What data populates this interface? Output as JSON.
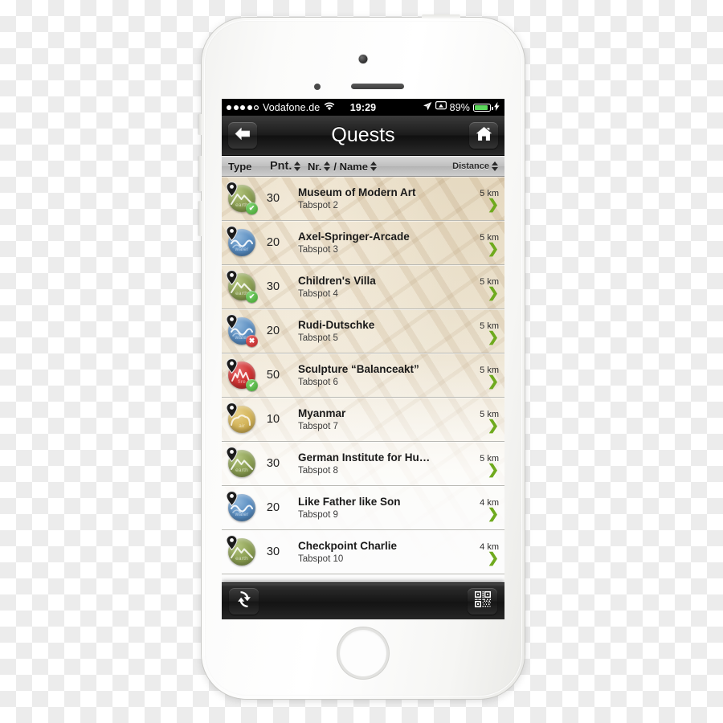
{
  "status_bar": {
    "signal_dots_filled": 4,
    "signal_dots_total": 5,
    "carrier": "Vodafone.de",
    "wifi_icon": "wifi-icon",
    "time": "19:29",
    "location_icon": "location-arrow-icon",
    "airplay_icon": "airplay-icon",
    "battery_percent": "89%",
    "battery_level": 89,
    "charging_icon": "lightning-bolt-icon"
  },
  "nav_bar": {
    "back_icon": "back-arrow-icon",
    "title": "Quests",
    "home_icon": "home-icon"
  },
  "table_header": {
    "type": "Type",
    "points": "Pnt.",
    "number": "Nr.",
    "name": "/ Name",
    "distance": "Distance",
    "sort_icon": "sort-updown-icon"
  },
  "colors": {
    "earth": "#8da055",
    "water": "#5c8fc2",
    "fire": "#cf3434",
    "air": "#d4b55b",
    "chevron_green": "#6faa1e",
    "battery_green": "#5bd75b"
  },
  "quests": [
    {
      "element": "earth",
      "element_label": "earth",
      "status": "ok",
      "points": "30",
      "name": "Museum of Modern Art",
      "subtitle": "Tabspot 2",
      "distance": "5 km"
    },
    {
      "element": "water",
      "element_label": "water",
      "status": "none",
      "points": "20",
      "name": "Axel-Springer-Arcade",
      "subtitle": "Tabspot 3",
      "distance": "5 km"
    },
    {
      "element": "earth",
      "element_label": "earth",
      "status": "ok",
      "points": "30",
      "name": "Children's Villa",
      "subtitle": "Tabspot 4",
      "distance": "5 km"
    },
    {
      "element": "water",
      "element_label": "water",
      "status": "no",
      "points": "20",
      "name": "Rudi-Dutschke",
      "subtitle": "Tabspot 5",
      "distance": "5 km"
    },
    {
      "element": "fire",
      "element_label": "fire",
      "status": "ok",
      "points": "50",
      "name": "Sculpture “Balanceakt”",
      "subtitle": "Tabspot 6",
      "distance": "5 km"
    },
    {
      "element": "air",
      "element_label": "air",
      "status": "none",
      "points": "10",
      "name": "Myanmar",
      "subtitle": "Tabspot 7",
      "distance": "5 km"
    },
    {
      "element": "earth",
      "element_label": "earth",
      "status": "none",
      "points": "30",
      "name": "German Institute for Hu…",
      "subtitle": "Tabspot 8",
      "distance": "5 km"
    },
    {
      "element": "water",
      "element_label": "water",
      "status": "none",
      "points": "20",
      "name": "Like Father like Son",
      "subtitle": "Tabspot 9",
      "distance": "4 km"
    },
    {
      "element": "earth",
      "element_label": "earth",
      "status": "none",
      "points": "30",
      "name": "Checkpoint Charlie",
      "subtitle": "Tabspot 10",
      "distance": "4 km"
    }
  ],
  "toolbar": {
    "refresh_icon": "refresh-sync-icon",
    "qr_icon": "qr-code-scan-icon"
  },
  "status_glyphs": {
    "ok": "✔",
    "no": "✖"
  },
  "chevron_glyph": "❯"
}
